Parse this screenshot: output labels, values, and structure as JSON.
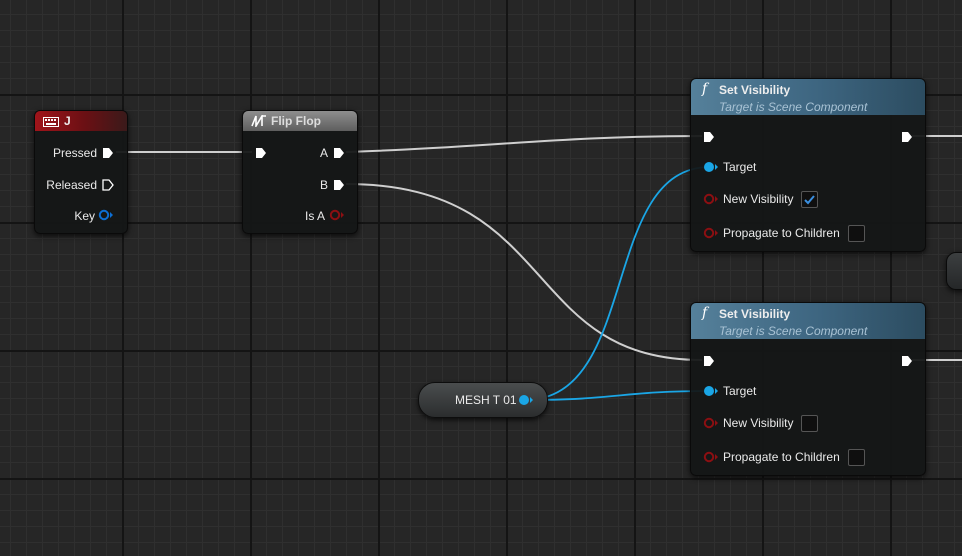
{
  "key_event": {
    "title": "J",
    "pins": {
      "pressed": "Pressed",
      "released": "Released",
      "key": "Key"
    }
  },
  "flip_flop": {
    "title": "Flip Flop",
    "pins": {
      "a": "A",
      "b": "B",
      "is_a": "Is A"
    }
  },
  "set_visibility_nodes": [
    {
      "title": "Set Visibility",
      "subtitle": "Target is Scene Component",
      "target_label": "Target",
      "new_visibility_label": "New Visibility",
      "new_visibility": true,
      "propagate_label": "Propagate to Children",
      "propagate": false
    },
    {
      "title": "Set Visibility",
      "subtitle": "Target is Scene Component",
      "target_label": "Target",
      "new_visibility_label": "New Visibility",
      "new_visibility": false,
      "propagate_label": "Propagate to Children",
      "propagate": false
    }
  ],
  "variable": {
    "name": "MESH T 01"
  },
  "colors": {
    "exec_wire": "#cfcfcf",
    "object_pin": "#1aa6e6",
    "bool_pin": "#8c0f12",
    "struct_pin": "#0d6fd4",
    "event_header": "#a0141a",
    "function_header": "#4d7893"
  }
}
